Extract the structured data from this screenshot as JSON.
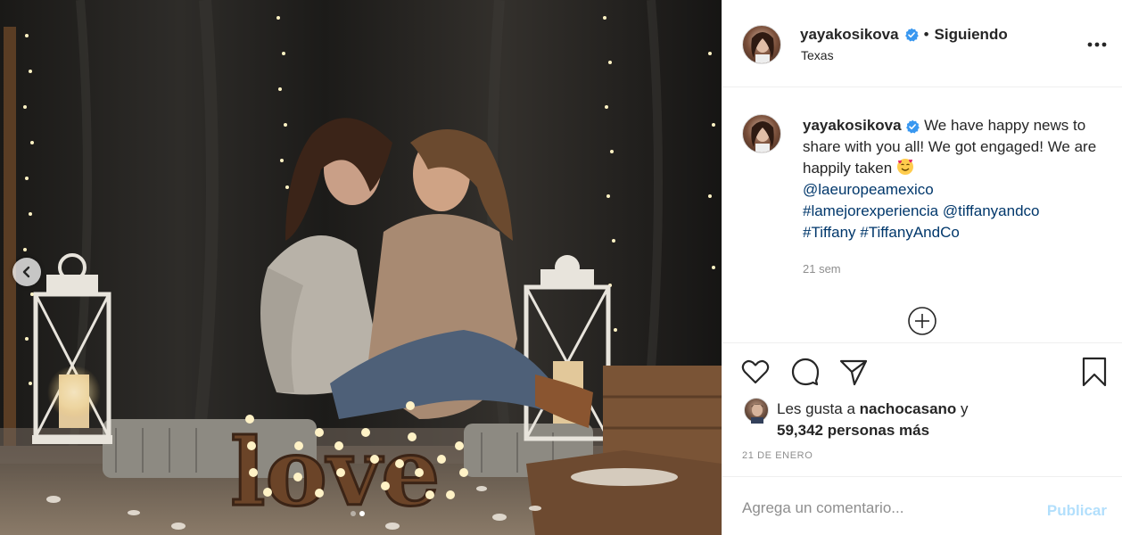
{
  "post": {
    "username": "yayakosikova",
    "follow_status": "Siguiendo",
    "location": "Texas",
    "caption": {
      "text": "We have happy news to share with you all! We got engaged! We are happily taken",
      "mention_1": "@laeuropeamexico",
      "hashtag_1": "#lamejorexperiencia",
      "mention_2": "@tiffanyandco",
      "hashtag_2": "#Tiffany",
      "hashtag_3": "#TiffanyAndCo"
    },
    "caption_time": "21 sem",
    "likes": {
      "prefix": "Les gusta a",
      "liker": "nachocasano",
      "joiner": "y",
      "count_text": "59,342 personas más"
    },
    "date": "21 DE ENERO",
    "photo_sign": "love"
  },
  "comment_box": {
    "placeholder": "Agrega un comentario...",
    "publish_label": "Publicar"
  },
  "icons": {
    "verified": "verified-badge-icon",
    "more": "more-options-icon",
    "like": "heart-icon",
    "comment": "comment-icon",
    "share": "share-icon",
    "save": "bookmark-icon",
    "load_more": "plus-circle-icon",
    "prev": "chevron-left-icon",
    "emoji": "smiling-face-with-hearts-icon"
  },
  "colors": {
    "verified_blue": "#3897f0",
    "link_blue": "#00376b",
    "publish_disabled": "#b2dffc",
    "muted_text": "#8e8e8e"
  },
  "carousel": {
    "total": 2,
    "current": 2
  }
}
